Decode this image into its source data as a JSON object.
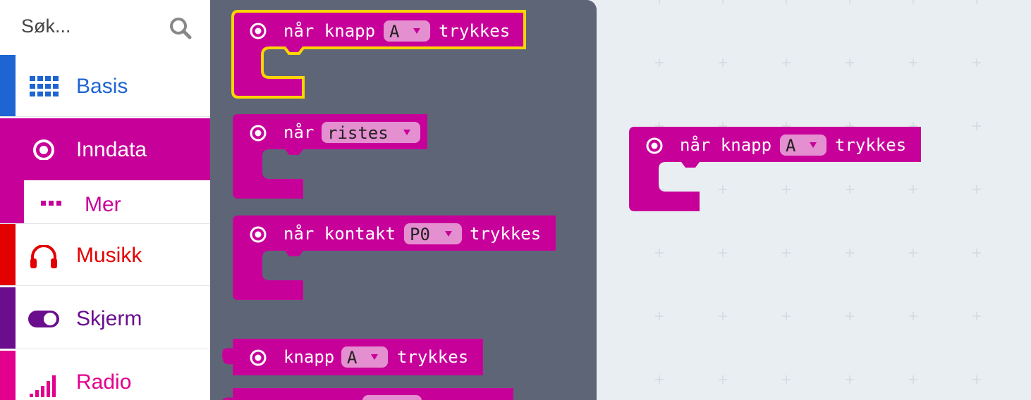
{
  "search": {
    "text": "Søk..."
  },
  "categories": [
    {
      "label": "Basis",
      "color": "#1e64d2",
      "icon": "grid-icon"
    },
    {
      "label": "Inndata",
      "color": "#c8009a",
      "icon": "radio-button-icon"
    },
    {
      "label": "Mer",
      "color": "#c8009a",
      "icon": "more-dots-icon"
    },
    {
      "label": "Musikk",
      "color": "#e30000",
      "icon": "headphones-icon"
    },
    {
      "label": "Skjerm",
      "color": "#6a0e8e",
      "icon": "toggle-icon"
    },
    {
      "label": "Radio",
      "color": "#e3008c",
      "icon": "signal-bars-icon"
    }
  ],
  "flyout": {
    "block1": {
      "pre": "når knapp",
      "dropdown": "A",
      "post": "trykkes"
    },
    "block2": {
      "pre": "når",
      "dropdown": "ristes"
    },
    "block3": {
      "pre": "når kontakt",
      "dropdown": "P0",
      "post": "trykkes"
    },
    "block4": {
      "pre": "knapp",
      "dropdown": "A",
      "post": "trykkes"
    }
  },
  "workspace": {
    "block1": {
      "pre": "når knapp",
      "dropdown": "A",
      "post": "trykkes"
    }
  },
  "colors": {
    "input": "#c8009a",
    "highlight": "#ffd500",
    "flyout_bg": "#5e6577"
  }
}
